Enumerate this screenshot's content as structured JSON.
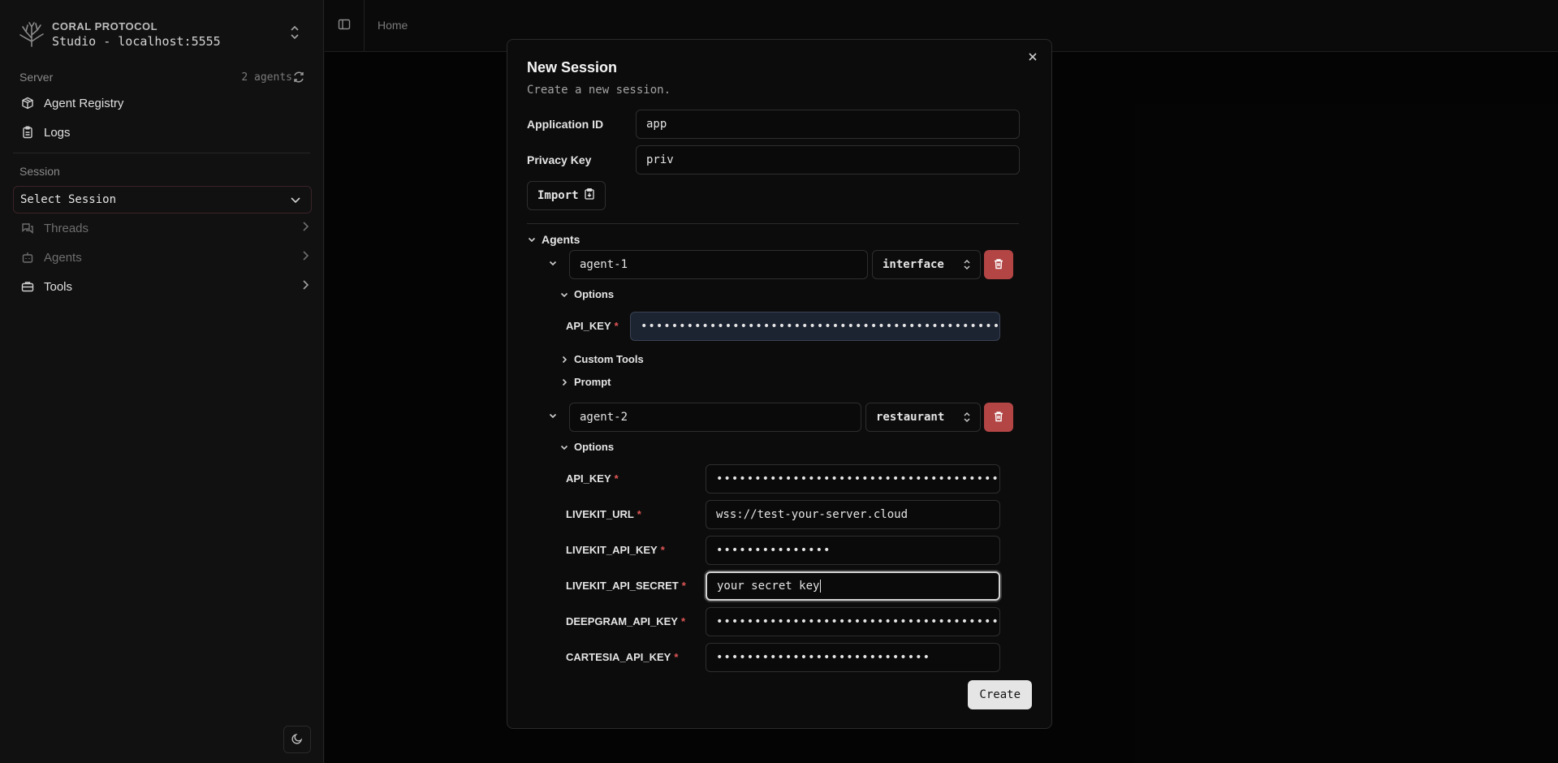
{
  "brand": {
    "name": "CORAL PROTOCOL",
    "subtitle": "Studio - localhost:5555"
  },
  "sidebar": {
    "server_label": "Server",
    "agents_count": "2 agents",
    "server_items": [
      {
        "label": "Agent Registry",
        "icon": "package-icon"
      },
      {
        "label": "Logs",
        "icon": "clipboard-icon"
      }
    ],
    "session_label": "Session",
    "select_session": "Select Session",
    "session_items": [
      {
        "label": "Threads",
        "icon": "messages-icon",
        "enabled": false
      },
      {
        "label": "Agents",
        "icon": "bot-icon",
        "enabled": false
      },
      {
        "label": "Tools",
        "icon": "briefcase-icon",
        "enabled": true
      }
    ]
  },
  "header": {
    "breadcrumb": "Home"
  },
  "modal": {
    "title": "New Session",
    "description": "Create a new session.",
    "application_id_label": "Application ID",
    "application_id_value": "app",
    "privacy_key_label": "Privacy Key",
    "privacy_key_value": "priv",
    "import_label": "Import",
    "agents_label": "Agents",
    "agent1": {
      "name": "agent-1",
      "type": "interface",
      "options_label": "Options",
      "api_key_label": "API_KEY",
      "api_key_value": "••••••••••••••••••••••••••••••••••••••••••••••••",
      "custom_tools_label": "Custom Tools",
      "prompt_label": "Prompt"
    },
    "agent2": {
      "name": "agent-2",
      "type": "restaurant",
      "options_label": "Options",
      "fields": [
        {
          "label": "API_KEY",
          "value": "•••••••••••••••••••••••••••••••••••••••"
        },
        {
          "label": "LIVEKIT_URL",
          "value": "wss://test-your-server.cloud"
        },
        {
          "label": "LIVEKIT_API_KEY",
          "value": "•••••••••••••••"
        },
        {
          "label": "LIVEKIT_API_SECRET",
          "value": "your secret key"
        },
        {
          "label": "DEEPGRAM_API_KEY",
          "value": "•••••••••••••••••••••••••••••••••••••••"
        },
        {
          "label": "CARTESIA_API_KEY",
          "value": "••••••••••••••••••••••••••••"
        }
      ]
    },
    "create_label": "Create",
    "required_mark": "*"
  },
  "colors": {
    "danger": "#b34545",
    "accent_input": "#1c2331",
    "background": "#0a0a0a"
  }
}
